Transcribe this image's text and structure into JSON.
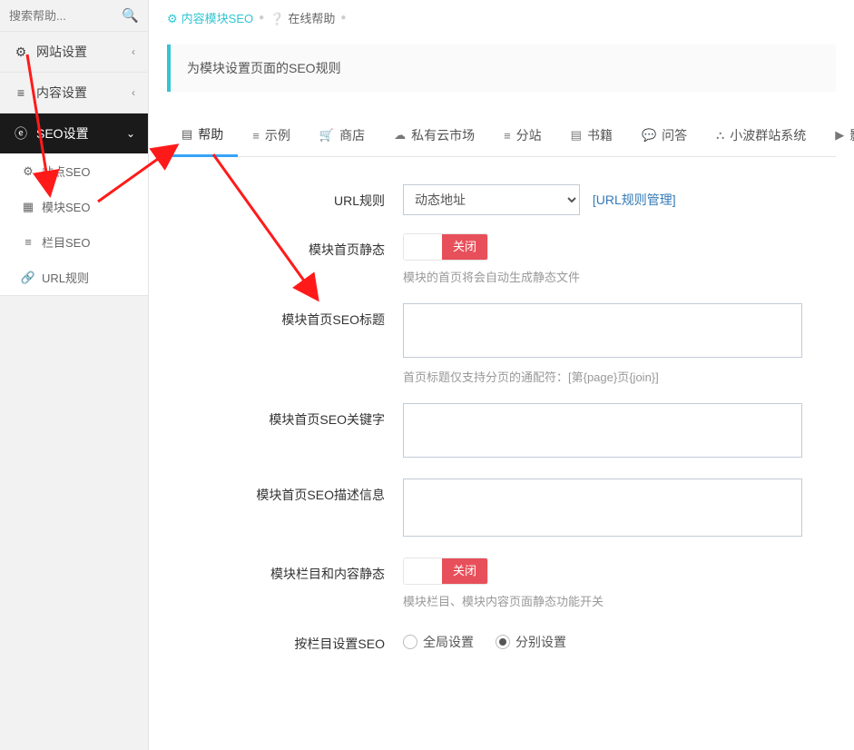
{
  "sidebar": {
    "search_placeholder": "搜索帮助...",
    "groups": [
      {
        "icon": "⚙",
        "label": "网站设置",
        "chev": "‹"
      },
      {
        "icon": "≡",
        "label": "内容设置",
        "chev": "‹"
      },
      {
        "icon": "ⓔ",
        "label": "SEO设置",
        "chev": "⌄",
        "active": true
      }
    ],
    "sub": [
      {
        "icon": "⚙",
        "label": "站点SEO"
      },
      {
        "icon": "▦",
        "label": "模块SEO"
      },
      {
        "icon": "≡",
        "label": "栏目SEO"
      },
      {
        "icon": "🔗",
        "label": "URL规则"
      }
    ]
  },
  "breadcrumb": {
    "item1": "内容模块SEO",
    "item2": "在线帮助"
  },
  "info": "为模块设置页面的SEO规则",
  "tabs": [
    {
      "icon": "▤",
      "label": "帮助"
    },
    {
      "icon": "≡",
      "label": "示例"
    },
    {
      "icon": "🛒",
      "label": "商店"
    },
    {
      "icon": "☁",
      "label": "私有云市场"
    },
    {
      "icon": "≡",
      "label": "分站"
    },
    {
      "icon": "▤",
      "label": "书籍"
    },
    {
      "icon": "💬",
      "label": "问答"
    },
    {
      "icon": "⛬",
      "label": "小波群站系统"
    },
    {
      "icon": "▶",
      "label": "影"
    }
  ],
  "form": {
    "url_label": "URL规则",
    "url_select": "动态地址",
    "url_link": "[URL规则管理]",
    "home_static_label": "模块首页静态",
    "toggle_off": "关闭",
    "home_static_help": "模块的首页将会自动生成静态文件",
    "home_title_label": "模块首页SEO标题",
    "home_title_help": "首页标题仅支持分页的通配符：[第{page}页{join}]",
    "home_kw_label": "模块首页SEO关键字",
    "home_desc_label": "模块首页SEO描述信息",
    "cat_static_label": "模块栏目和内容静态",
    "cat_static_help": "模块栏目、模块内容页面静态功能开关",
    "per_cat_label": "按栏目设置SEO",
    "radio1": "全局设置",
    "radio2": "分别设置"
  }
}
